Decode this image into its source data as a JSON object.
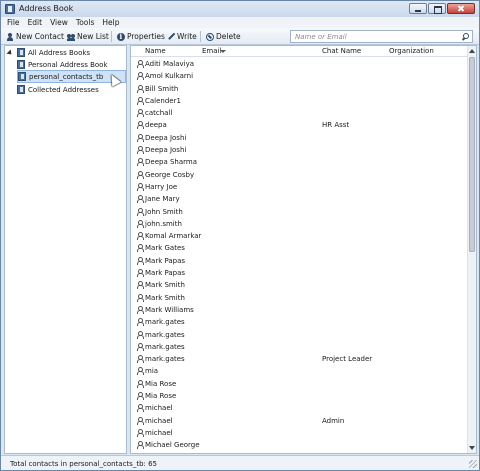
{
  "window": {
    "title": "Address Book"
  },
  "menu": [
    "File",
    "Edit",
    "View",
    "Tools",
    "Help"
  ],
  "toolbar": {
    "new_contact": "New Contact",
    "new_list": "New List",
    "properties": "Properties",
    "write": "Write",
    "delete": "Delete",
    "search_placeholder": "Name or Email"
  },
  "tree": {
    "root": "All Address Books",
    "items": [
      "Personal Address Book",
      "personal_contacts_tb",
      "Collected Addresses"
    ],
    "selected": "personal_contacts_tb"
  },
  "columns": {
    "name": "Name",
    "email": "Email",
    "chat": "Chat Name",
    "org": "Organization"
  },
  "contacts": [
    {
      "name": "Aditi Malaviya",
      "chat": ""
    },
    {
      "name": "Amol Kulkarni",
      "chat": ""
    },
    {
      "name": "Bill Smith",
      "chat": ""
    },
    {
      "name": "Calender1",
      "chat": ""
    },
    {
      "name": "catchall",
      "chat": ""
    },
    {
      "name": "deepa",
      "chat": "HR Asst"
    },
    {
      "name": "Deepa Joshi",
      "chat": ""
    },
    {
      "name": "Deepa Joshi",
      "chat": ""
    },
    {
      "name": "Deepa Sharma",
      "chat": ""
    },
    {
      "name": "George Cosby",
      "chat": ""
    },
    {
      "name": "Harry Joe",
      "chat": ""
    },
    {
      "name": "Jane Mary",
      "chat": ""
    },
    {
      "name": "John  Smith",
      "chat": ""
    },
    {
      "name": "john.smith",
      "chat": ""
    },
    {
      "name": "Komal Armarkar",
      "chat": ""
    },
    {
      "name": "Mark Gates",
      "chat": ""
    },
    {
      "name": "Mark Papas",
      "chat": ""
    },
    {
      "name": "Mark Papas",
      "chat": ""
    },
    {
      "name": "Mark Smith",
      "chat": ""
    },
    {
      "name": "Mark Smith",
      "chat": ""
    },
    {
      "name": "Mark Williams",
      "chat": ""
    },
    {
      "name": "mark.gates",
      "chat": ""
    },
    {
      "name": "mark.gates",
      "chat": ""
    },
    {
      "name": "mark.gates",
      "chat": ""
    },
    {
      "name": "mark.gates",
      "chat": "Project Leader"
    },
    {
      "name": "mia",
      "chat": ""
    },
    {
      "name": "Mia Rose",
      "chat": ""
    },
    {
      "name": "Mia Rose",
      "chat": ""
    },
    {
      "name": "michael",
      "chat": ""
    },
    {
      "name": "michael",
      "chat": "Admin"
    },
    {
      "name": "michael",
      "chat": ""
    },
    {
      "name": "Michael George",
      "chat": ""
    }
  ],
  "status": {
    "text": "Total contacts in personal_contacts_tb: 65"
  }
}
